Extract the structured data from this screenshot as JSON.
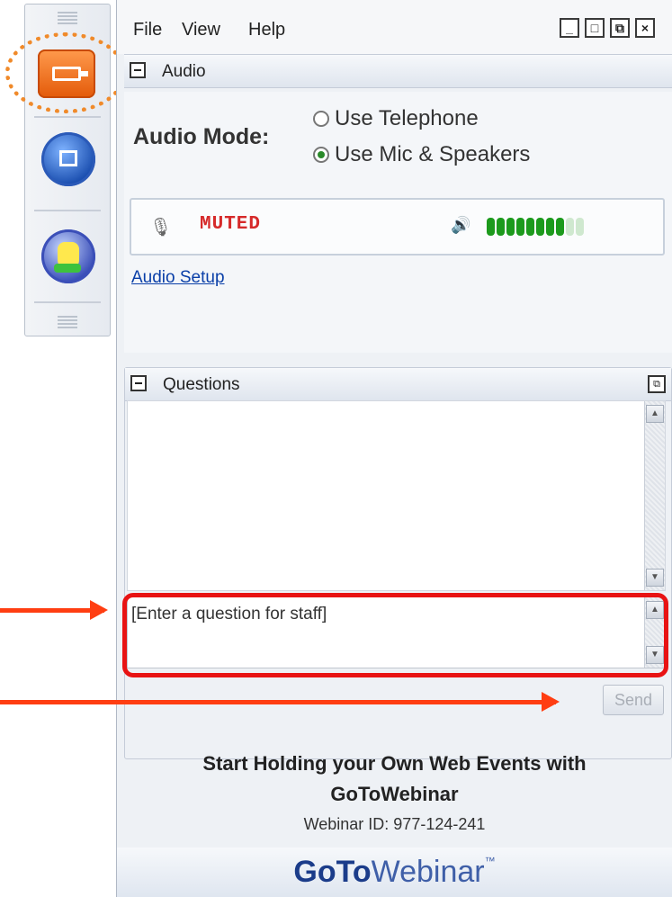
{
  "menu": {
    "file": "File",
    "view": "View",
    "help": "Help"
  },
  "window_buttons": [
    "minimize",
    "maximize",
    "restore",
    "close"
  ],
  "audio": {
    "section_title": "Audio",
    "mode_label": "Audio Mode:",
    "options": [
      {
        "label": "Use Telephone",
        "selected": false
      },
      {
        "label": "Use Mic & Speakers",
        "selected": true
      }
    ],
    "mic_status": "MUTED",
    "speaker_level_segments": 10,
    "speaker_level_on": 8,
    "setup_link": "Audio Setup"
  },
  "questions": {
    "section_title": "Questions",
    "input_placeholder": "[Enter a question for staff]",
    "send_label": "Send"
  },
  "promo": {
    "line1": "Start Holding your Own Web Events with",
    "line2": "GoToWebinar",
    "webinar_id": "Webinar ID: 977-124-241"
  },
  "brand": {
    "bold": "GoTo",
    "light": "Webinar",
    "mark": "™"
  },
  "colors": {
    "muted": "#d62a2a",
    "link": "#0a3fa8",
    "accent": "#f08a2a",
    "callout": "#e81313"
  }
}
